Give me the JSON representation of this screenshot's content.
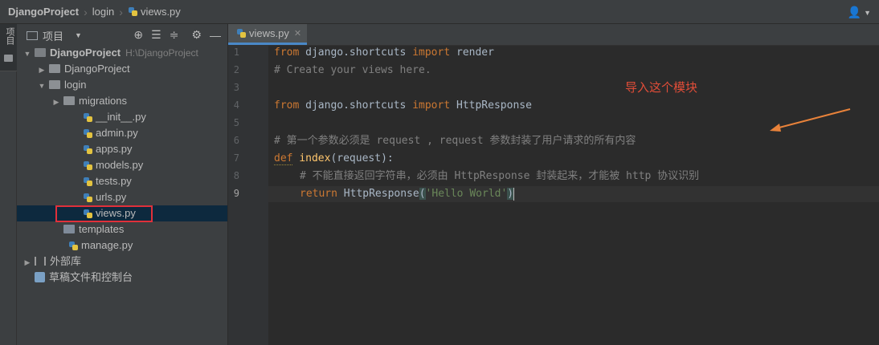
{
  "breadcrumb": {
    "project": "DjangoProject",
    "folder": "login",
    "file": "views.py"
  },
  "left_strip": {
    "tab_label": "项目"
  },
  "project_panel": {
    "title": "项目",
    "header_icons": [
      "locate-icon",
      "expand-all-icon",
      "collapse-all-icon",
      "settings-gear-icon",
      "hide-icon"
    ],
    "tree": [
      {
        "label": "DjangoProject",
        "hint": "H:\\DjangoProject",
        "type": "folder",
        "expanded": true,
        "depth": 0
      },
      {
        "label": "DjangoProject",
        "type": "folder",
        "expanded": false,
        "depth": 1
      },
      {
        "label": "login",
        "type": "folder",
        "expanded": true,
        "depth": 1
      },
      {
        "label": "migrations",
        "type": "folder",
        "expanded": false,
        "depth": 2
      },
      {
        "label": "__init__.py",
        "type": "python",
        "depth": 3
      },
      {
        "label": "admin.py",
        "type": "python",
        "depth": 3
      },
      {
        "label": "apps.py",
        "type": "python",
        "depth": 3
      },
      {
        "label": "models.py",
        "type": "python",
        "depth": 3
      },
      {
        "label": "tests.py",
        "type": "python",
        "depth": 3
      },
      {
        "label": "urls.py",
        "type": "python",
        "depth": 3
      },
      {
        "label": "views.py",
        "type": "python",
        "depth": 3,
        "selected": true
      },
      {
        "label": "templates",
        "type": "folder",
        "depth": 2
      },
      {
        "label": "manage.py",
        "type": "python",
        "depth": 2
      },
      {
        "label": "外部库",
        "type": "library",
        "depth": 0
      },
      {
        "label": "草稿文件和控制台",
        "type": "scratch",
        "depth": 0
      }
    ]
  },
  "editor": {
    "tab_label": "views.py",
    "current_line": 9,
    "line_numbers": [
      "1",
      "2",
      "3",
      "4",
      "5",
      "6",
      "7",
      "8",
      "9"
    ],
    "lines": {
      "l1_kw": "from",
      "l1_mod": " django.shortcuts ",
      "l1_kw2": "import",
      "l1_rest": " render",
      "l2": "# Create your views here.",
      "l4_kw": "from",
      "l4_mod": " django.shortcuts ",
      "l4_kw2": "import",
      "l4_rest": " HttpResponse",
      "l6": "# 第一个参数必须是 request , request 参数封装了用户请求的所有内容",
      "l7_kw": "def",
      "l7_fn": "index",
      "l7_rest": "(request):",
      "l8": "# 不能直接返回字符串，必须由 HttpResponse 封装起来，才能被 http 协议识别",
      "l9_kw": "return",
      "l9_call": " HttpResponse",
      "l9_open": "(",
      "l9_str": "'Hello World'",
      "l9_close": ")"
    }
  },
  "annotation": {
    "text": "导入这个模块",
    "color": "#e14d38"
  },
  "colors": {
    "keyword": "#cc7832",
    "comment": "#808080",
    "function": "#ffc66d",
    "string": "#6a8759",
    "selection_box": "#e0303a"
  }
}
